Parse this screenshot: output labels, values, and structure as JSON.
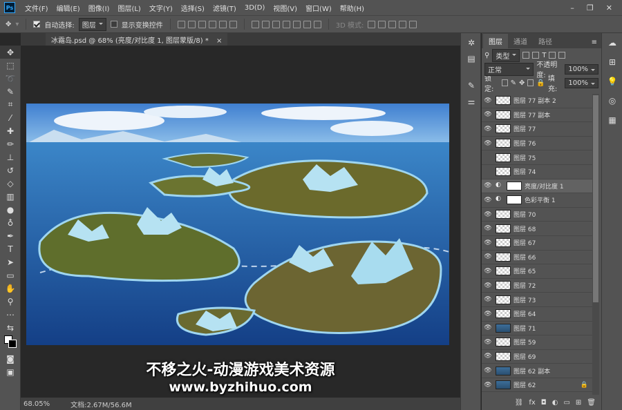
{
  "menubar": {
    "logo": "Ps",
    "items": [
      "文件(F)",
      "编辑(E)",
      "图像(I)",
      "图层(L)",
      "文字(Y)",
      "选择(S)",
      "滤镜(T)",
      "3D(D)",
      "视图(V)",
      "窗口(W)",
      "帮助(H)"
    ],
    "window_controls": [
      "–",
      "❐",
      "✕"
    ]
  },
  "options": {
    "auto_select_label": "自动选择:",
    "auto_select_value": "图层",
    "show_transform_label": "显示变换控件",
    "mode_3d_label": "3D 模式:"
  },
  "document": {
    "tab_title": "冰霜岛.psd @ 68% (亮度/对比度 1, 图层蒙版/8) *",
    "close": "×"
  },
  "watermark": {
    "line1": "不移之火-动漫游戏美术资源",
    "line2": "www.byzhihuo.com"
  },
  "status": {
    "zoom": "68.05%",
    "doc_size": "文档:2.67M/56.6M"
  },
  "layers_panel": {
    "tabs": [
      "图层",
      "通道",
      "路径"
    ],
    "filter_kind": "类型",
    "blend_mode": "正常",
    "opacity_label": "不透明度:",
    "opacity_value": "100%",
    "lock_label": "锁定:",
    "fill_label": "填充:",
    "fill_value": "100%",
    "layers": [
      {
        "name": "图层 77 副本 2",
        "visible": true,
        "type": "pixel"
      },
      {
        "name": "图层 77 副本",
        "visible": true,
        "type": "pixel"
      },
      {
        "name": "图层 77",
        "visible": true,
        "type": "pixel"
      },
      {
        "name": "图层 76",
        "visible": true,
        "type": "pixel"
      },
      {
        "name": "图层 75",
        "visible": false,
        "type": "pixel"
      },
      {
        "name": "图层 74",
        "visible": false,
        "type": "pixel"
      },
      {
        "name": "亮度/对比度 1",
        "visible": true,
        "type": "adjustment",
        "selected": true
      },
      {
        "name": "色彩平衡 1",
        "visible": true,
        "type": "adjustment"
      },
      {
        "name": "图层 70",
        "visible": true,
        "type": "pixel"
      },
      {
        "name": "图层 68",
        "visible": true,
        "type": "pixel"
      },
      {
        "name": "图层 67",
        "visible": true,
        "type": "pixel"
      },
      {
        "name": "图层 66",
        "visible": true,
        "type": "pixel"
      },
      {
        "name": "图层 65",
        "visible": true,
        "type": "pixel"
      },
      {
        "name": "图层 72",
        "visible": true,
        "type": "pixel"
      },
      {
        "name": "图层 73",
        "visible": true,
        "type": "pixel"
      },
      {
        "name": "图层 64",
        "visible": true,
        "type": "pixel"
      },
      {
        "name": "图层 71",
        "visible": true,
        "type": "image"
      },
      {
        "name": "图层 59",
        "visible": true,
        "type": "pixel"
      },
      {
        "name": "图层 69",
        "visible": true,
        "type": "pixel"
      },
      {
        "name": "图层 62 副本",
        "visible": true,
        "type": "image"
      },
      {
        "name": "图层 62",
        "visible": true,
        "type": "image",
        "locked": true
      }
    ],
    "bottom_icons": [
      "link-icon",
      "fx-icon",
      "mask-icon",
      "adjustment-icon",
      "folder-icon",
      "new-layer-icon",
      "trash-icon"
    ],
    "bottom_glyphs": [
      "⛓",
      "fx",
      "◘",
      "◐",
      "▭",
      "⊞",
      "🗑"
    ]
  },
  "colors": {
    "chrome": "#535353",
    "canvas_bg": "#282828",
    "sea": "#1f5fae",
    "sky": "#4f8fd8"
  }
}
